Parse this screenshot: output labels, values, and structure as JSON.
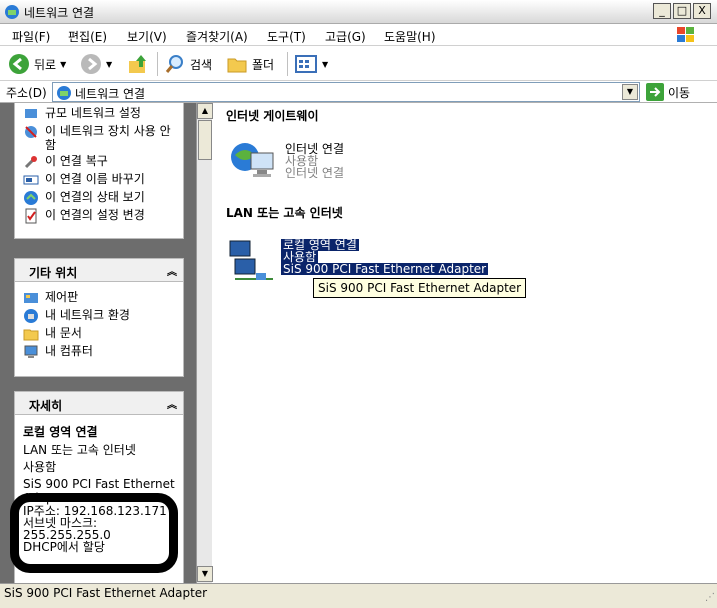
{
  "window": {
    "title": "네트워크 연결",
    "controls": [
      "_",
      "□",
      "X"
    ]
  },
  "menu": [
    "파일(F)",
    "편집(E)",
    "보기(V)",
    "즐겨찾기(A)",
    "도구(T)",
    "고급(G)",
    "도움말(H)"
  ],
  "toolbar": {
    "back": "뒤로",
    "search": "검색",
    "folders": "폴더"
  },
  "address": {
    "label": "주소(D)",
    "value": "네트워크 연결",
    "go": "이동"
  },
  "left_tasks": {
    "items": [
      "규모 네트워크 설정",
      "이 네트워크 장치 사용 안 함",
      "이 연결 복구",
      "이 연결 이름 바꾸기",
      "이 연결의 상태 보기",
      "이 연결의 설정 변경"
    ]
  },
  "other_places": {
    "title": "기타 위치",
    "items": [
      "제어판",
      "내 네트워크 환경",
      "내 문서",
      "내 컴퓨터"
    ]
  },
  "details": {
    "title": "자세히",
    "name": "로컬 영역 연결",
    "type": "LAN 또는 고속 인터넷",
    "status": "사용함",
    "device": "SiS 900 PCI Fast Ethernet Adapter",
    "ip": "IP주소: 192.168.123.171",
    "subnet_label": "서브넷 마스크:",
    "subnet": "255.255.255.0",
    "dhcp": "DHCP에서 할당"
  },
  "groups": {
    "gateway": {
      "title": "인터넷 게이트웨이",
      "name": "인터넷 연결",
      "status": "사용함",
      "sub": "인터넷 연결"
    },
    "lan": {
      "title": "LAN 또는 고속 인터넷",
      "name": "로컬 영역 연결",
      "status": "사용함",
      "device": "SiS 900 PCI Fast Ethernet Adapter"
    }
  },
  "tooltip": "SiS 900 PCI Fast Ethernet Adapter",
  "status_bar": "SiS 900 PCI Fast Ethernet Adapter",
  "colors": {
    "selection": "#0a246a",
    "left_bg": "#6d6d6d",
    "tooltip_bg": "#ffffe1"
  }
}
